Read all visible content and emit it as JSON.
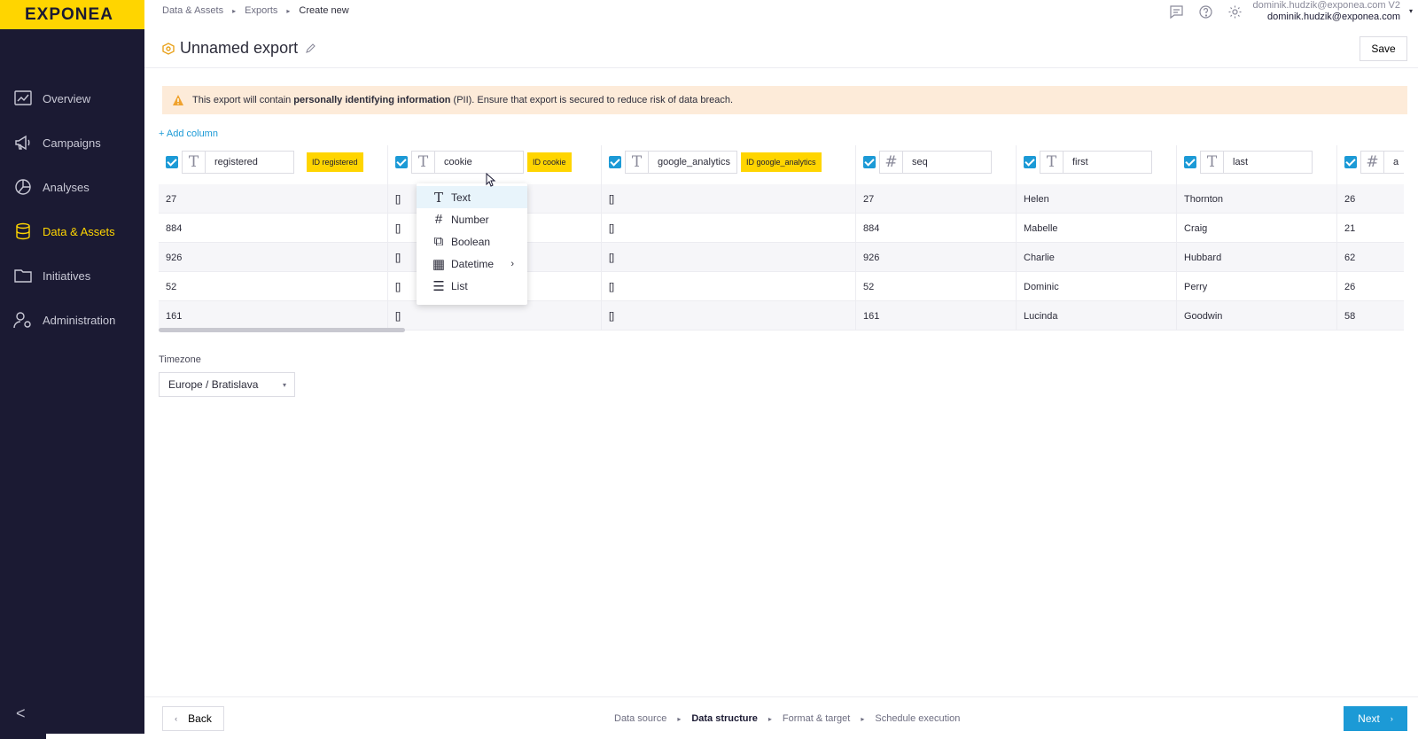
{
  "brand": {
    "logo_text": "EXPONEA",
    "accent": "#ffd500",
    "sidebar_bg": "#1b1a33",
    "link_color": "#1c9ad6"
  },
  "sidebar": {
    "items": [
      {
        "label": "Overview",
        "icon": "overview-icon"
      },
      {
        "label": "Campaigns",
        "icon": "megaphone-icon"
      },
      {
        "label": "Analyses",
        "icon": "pie-chart-icon"
      },
      {
        "label": "Data & Assets",
        "icon": "database-icon",
        "active": true
      },
      {
        "label": "Initiatives",
        "icon": "folder-icon"
      },
      {
        "label": "Administration",
        "icon": "user-settings-icon"
      }
    ],
    "collapse": "<"
  },
  "breadcrumb": {
    "items": [
      "Data & Assets",
      "Exports",
      "Create new"
    ],
    "sep": "▸"
  },
  "user": {
    "line1": "dominik.hudzik@exponea.com V2",
    "line2": "dominik.hudzik@exponea.com",
    "caret": "▾"
  },
  "page": {
    "title": "Unnamed export",
    "save_label": "Save"
  },
  "banner": {
    "pre": "This export will contain",
    "bold": "personally identifying information",
    "post": "(PII). Ensure that export is secured to reduce risk of data breach."
  },
  "add_column": "+ Add column",
  "columns": [
    {
      "type_glyph": "T",
      "name": "registered",
      "id_badge": "ID registered"
    },
    {
      "type_glyph": "T",
      "name": "cookie",
      "id_badge": "ID cookie"
    },
    {
      "type_glyph": "T",
      "name": "google_analytics",
      "id_badge": "ID google_analytics"
    },
    {
      "type_glyph": "#",
      "name": "seq",
      "id_badge": ""
    },
    {
      "type_glyph": "T",
      "name": "first",
      "id_badge": ""
    },
    {
      "type_glyph": "T",
      "name": "last",
      "id_badge": ""
    },
    {
      "type_glyph": "#",
      "name": "a",
      "id_badge": ""
    }
  ],
  "rows": [
    [
      "27",
      "[]",
      "[]",
      "27",
      "Helen",
      "Thornton",
      "26"
    ],
    [
      "884",
      "[]",
      "[]",
      "884",
      "Mabelle",
      "Craig",
      "21"
    ],
    [
      "926",
      "[]",
      "[]",
      "926",
      "Charlie",
      "Hubbard",
      "62"
    ],
    [
      "52",
      "[]",
      "[]",
      "52",
      "Dominic",
      "Perry",
      "26"
    ],
    [
      "161",
      "[]",
      "[]",
      "161",
      "Lucinda",
      "Goodwin",
      "58"
    ]
  ],
  "type_menu": {
    "items": [
      {
        "label": "Text",
        "glyph": "T",
        "highlighted": true
      },
      {
        "label": "Number",
        "glyph": "#"
      },
      {
        "label": "Boolean",
        "glyph": "⧉"
      },
      {
        "label": "Datetime",
        "glyph": "▦",
        "submenu": "›"
      },
      {
        "label": "List",
        "glyph": "☰"
      }
    ]
  },
  "timezone": {
    "label": "Timezone",
    "value": "Europe / Bratislava",
    "caret": "▾"
  },
  "footer": {
    "back_label": "Back",
    "back_chevron": "‹",
    "steps": [
      {
        "label": "Data source"
      },
      {
        "label": "Data structure",
        "active": true
      },
      {
        "label": "Format & target"
      },
      {
        "label": "Schedule execution"
      }
    ],
    "step_sep": "▸",
    "next_label": "Next",
    "next_chevron": "›"
  }
}
